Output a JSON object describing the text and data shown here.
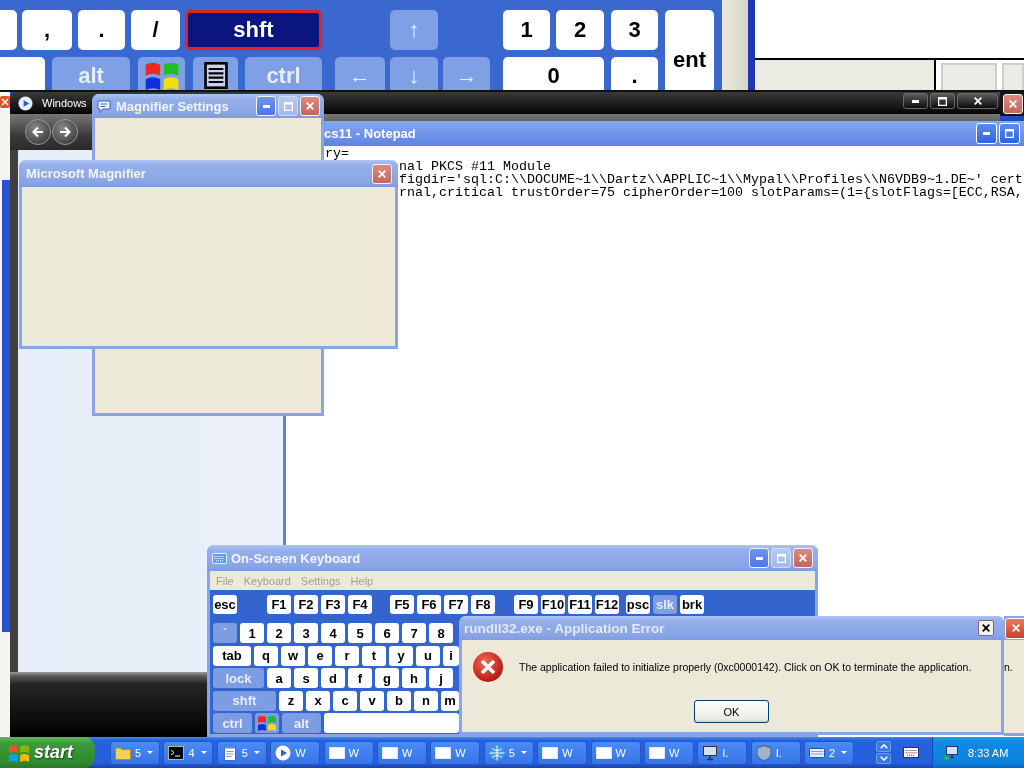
{
  "magnifier_view": {
    "keys": [
      {
        "kind": "key",
        "highlighted": false
      },
      {
        "label": ",",
        "kind": "key",
        "highlighted": false
      },
      {
        "label": ".",
        "kind": "key",
        "highlighted": false
      },
      {
        "label": "/",
        "kind": "key",
        "highlighted": false
      },
      {
        "label": "shft",
        "kind": "modifier",
        "highlighted": true
      },
      {
        "label": "↑",
        "kind": "modifier",
        "highlighted": false
      },
      {
        "label": "1",
        "kind": "key",
        "highlighted": false
      },
      {
        "label": "2",
        "kind": "key",
        "highlighted": false
      },
      {
        "label": "3",
        "kind": "key",
        "highlighted": false
      },
      {
        "label": "ent",
        "kind": "key",
        "highlighted": false
      },
      {
        "kind": "key",
        "highlighted": false
      },
      {
        "label": "alt",
        "kind": "modifier",
        "highlighted": false
      },
      {
        "kind": "logo",
        "highlighted": false
      },
      {
        "kind": "menu",
        "highlighted": false
      },
      {
        "label": "ctrl",
        "kind": "modifier",
        "highlighted": false
      },
      {
        "label": "←",
        "kind": "modifier",
        "highlighted": false
      },
      {
        "label": "↓",
        "kind": "modifier",
        "highlighted": false
      },
      {
        "label": "→",
        "kind": "modifier",
        "highlighted": false
      },
      {
        "label": "0",
        "kind": "key",
        "highlighted": false
      },
      {
        "label": ".",
        "kind": "key",
        "highlighted": false
      }
    ]
  },
  "background_window": {
    "controls": [
      {
        "kind": "close",
        "disabled": false
      }
    ]
  },
  "media_player": {
    "title": "Windows",
    "controls": [
      {
        "kind": "minimize",
        "disabled": false
      },
      {
        "kind": "maximize",
        "disabled": false
      },
      {
        "kind": "close",
        "disabled": false
      }
    ]
  },
  "notepad": {
    "title": "cs11 - Notepad",
    "controls": [
      {
        "kind": "minimize",
        "disabled": false
      },
      {
        "kind": "maximize",
        "disabled": false
      }
    ],
    "lines": [
      "ry=",
      "nal PKCS #11 Module",
      "figdir='sql:C:\\\\DOCUME~1\\\\Dartz\\\\APPLIC~1\\\\Mypal\\\\Profiles\\\\N6VDB9~1.DE~' cert",
      "rnal,critical trustOrder=75 cipherOrder=100 slotParams=(1={slotFlags=[ECC,RSA,"
    ]
  },
  "magnifier_settings": {
    "title": "Magnifier Settings",
    "controls": [
      {
        "kind": "minimize",
        "disabled": false
      },
      {
        "kind": "maximize",
        "disabled": true
      },
      {
        "kind": "close",
        "disabled": false
      }
    ]
  },
  "magnifier": {
    "title": "Microsoft Magnifier",
    "controls": [
      {
        "kind": "close",
        "disabled": false
      }
    ]
  },
  "on_screen_keyboard": {
    "title": "On-Screen Keyboard",
    "controls": [
      {
        "kind": "minimize",
        "disabled": false
      },
      {
        "kind": "maximize",
        "disabled": true
      },
      {
        "kind": "close",
        "disabled": false
      }
    ],
    "menu": [
      {
        "label": "File",
        "disabled": true
      },
      {
        "label": "Keyboard",
        "disabled": true
      },
      {
        "label": "Settings",
        "disabled": true
      },
      {
        "label": "Help",
        "disabled": true
      }
    ],
    "function_keys": [
      [
        {
          "label": "esc",
          "kind": "key"
        }
      ],
      [
        {
          "label": "F1",
          "kind": "key"
        },
        {
          "label": "F2",
          "kind": "key"
        },
        {
          "label": "F3",
          "kind": "key"
        },
        {
          "label": "F4",
          "kind": "key"
        }
      ],
      [
        {
          "label": "F5",
          "kind": "key"
        },
        {
          "label": "F6",
          "kind": "key"
        },
        {
          "label": "F7",
          "kind": "key"
        },
        {
          "label": "F8",
          "kind": "key"
        }
      ],
      [
        {
          "label": "F9",
          "kind": "key"
        },
        {
          "label": "F10",
          "kind": "key"
        },
        {
          "label": "F11",
          "kind": "key"
        },
        {
          "label": "F12",
          "kind": "key"
        }
      ],
      [
        {
          "label": "psc",
          "kind": "key"
        },
        {
          "label": "slk",
          "kind": "modifier"
        },
        {
          "label": "brk",
          "kind": "key"
        }
      ]
    ],
    "rows": [
      [
        {
          "label": "`",
          "kind": "modifier"
        },
        {
          "label": "1",
          "kind": "key"
        },
        {
          "label": "2",
          "kind": "key"
        },
        {
          "label": "3",
          "kind": "key"
        },
        {
          "label": "4",
          "kind": "key"
        },
        {
          "label": "5",
          "kind": "key"
        },
        {
          "label": "6",
          "kind": "key"
        },
        {
          "label": "7",
          "kind": "key"
        },
        {
          "label": "8",
          "kind": "key"
        }
      ],
      [
        {
          "label": "tab",
          "kind": "key"
        },
        {
          "label": "q",
          "kind": "key"
        },
        {
          "label": "w",
          "kind": "key"
        },
        {
          "label": "e",
          "kind": "key"
        },
        {
          "label": "r",
          "kind": "key"
        },
        {
          "label": "t",
          "kind": "key"
        },
        {
          "label": "y",
          "kind": "key"
        },
        {
          "label": "u",
          "kind": "key"
        },
        {
          "label": "i",
          "kind": "key"
        }
      ],
      [
        {
          "label": "lock",
          "kind": "modifier"
        },
        {
          "label": "a",
          "kind": "key"
        },
        {
          "label": "s",
          "kind": "key"
        },
        {
          "label": "d",
          "kind": "key"
        },
        {
          "label": "f",
          "kind": "key"
        },
        {
          "label": "g",
          "kind": "key"
        },
        {
          "label": "h",
          "kind": "key"
        },
        {
          "label": "j",
          "kind": "key"
        }
      ],
      [
        {
          "label": "shft",
          "kind": "modifier"
        },
        {
          "label": "z",
          "kind": "key"
        },
        {
          "label": "x",
          "kind": "key"
        },
        {
          "label": "c",
          "kind": "key"
        },
        {
          "label": "v",
          "kind": "key"
        },
        {
          "label": "b",
          "kind": "key"
        },
        {
          "label": "n",
          "kind": "key"
        },
        {
          "label": "m",
          "kind": "key"
        }
      ],
      [
        {
          "label": "ctrl",
          "kind": "modifier"
        },
        {
          "kind": "logo"
        },
        {
          "label": "alt",
          "kind": "modifier"
        },
        {
          "kind": "space"
        }
      ]
    ]
  },
  "background_dialog": {
    "text": "n.",
    "controls": [
      {
        "kind": "close",
        "disabled": false
      }
    ]
  },
  "error_dialog": {
    "title": "rundll32.exe - Application Error",
    "controls": [
      {
        "kind": "close",
        "disabled": false
      }
    ],
    "message": "The application failed to initialize properly (0xc0000142). Click on OK to terminate the application.",
    "button": "OK"
  },
  "taskbar": {
    "start": "start",
    "buttons": [
      {
        "label": "5",
        "kind": "folder",
        "group": true
      },
      {
        "label": "4",
        "kind": "console",
        "group": true
      },
      {
        "label": "5",
        "kind": "notepad",
        "group": true
      },
      {
        "label": "W",
        "kind": "player",
        "group": false
      },
      {
        "label": "W",
        "kind": "window",
        "group": false
      },
      {
        "label": "W",
        "kind": "window",
        "group": false
      },
      {
        "label": "W",
        "kind": "window",
        "group": false
      },
      {
        "label": "5",
        "kind": "browser",
        "group": true
      },
      {
        "label": "W",
        "kind": "window",
        "group": false
      },
      {
        "label": "W",
        "kind": "window",
        "group": false
      },
      {
        "label": "W",
        "kind": "window",
        "group": false
      },
      {
        "label": "I.",
        "kind": "installer",
        "group": false
      },
      {
        "label": "I.",
        "kind": "shield",
        "group": false
      },
      {
        "label": "2",
        "kind": "keyboard",
        "group": true
      }
    ],
    "clock": "8:33 AM"
  }
}
